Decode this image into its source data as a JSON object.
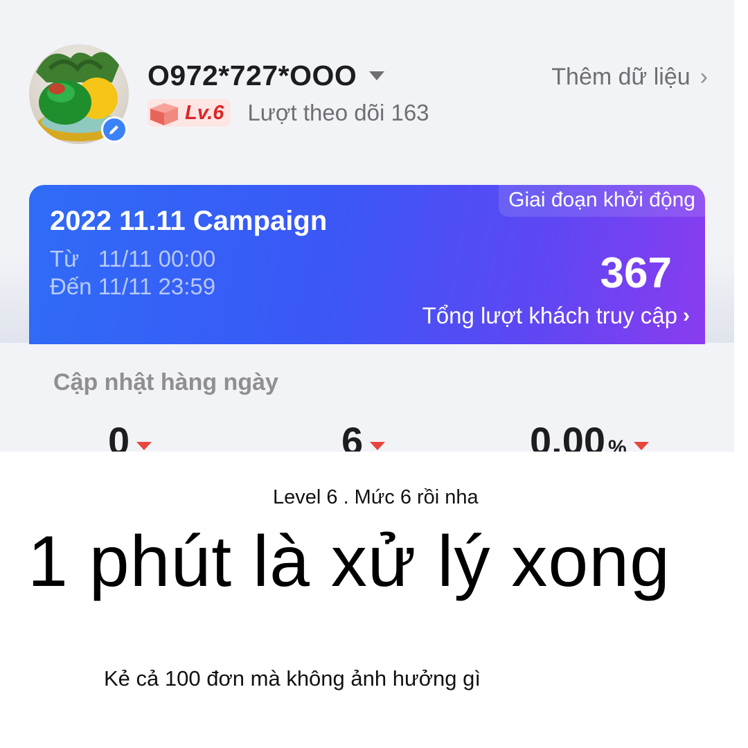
{
  "profile": {
    "phone": "O972*727*OOO",
    "level_label": "Lv.6",
    "followers": "Lượt theo dõi 163",
    "add_data": "Thêm dữ liệu"
  },
  "campaign": {
    "stage": "Giai đoạn khởi động",
    "title": "2022 11.11 Campaign",
    "from": "Từ   11/11 00:00",
    "to": "Đến 11/11 23:59",
    "visits": "367",
    "visits_label": "Tổng lượt khách truy cập"
  },
  "daily": {
    "title": "Cập nhật hàng ngày",
    "stats": [
      {
        "value": "0",
        "unit": "",
        "trend": "down"
      },
      {
        "value": "6",
        "unit": "",
        "trend": "down"
      },
      {
        "value": "0.00",
        "unit": "%",
        "trend": "down"
      }
    ]
  },
  "captions": {
    "level_note": "Level 6 . Mức 6 rồi nha",
    "headline": "1 phút là xử lý xong",
    "footnote": "Kẻ cả 100 đơn mà không ảnh hưởng gì"
  },
  "colors": {
    "campaign_start": "#2f6cf6",
    "campaign_end": "#8a3cf0",
    "level_red": "#d92626",
    "trend_down": "#e8453c",
    "edit_blue": "#3b82f6"
  }
}
